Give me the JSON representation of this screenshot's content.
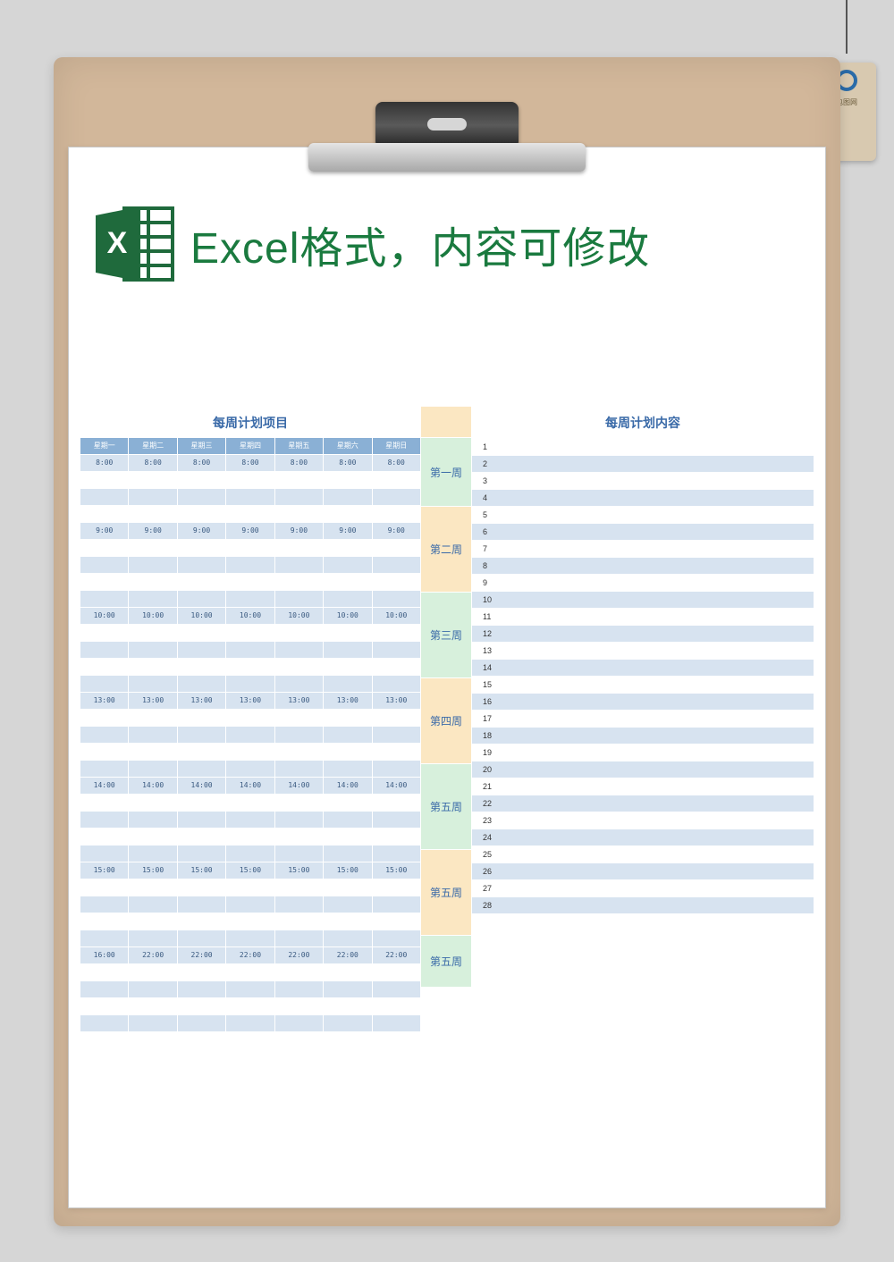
{
  "header_title": "Excel格式，内容可修改",
  "tag_text": "包图网",
  "left_title": "每周计划项目",
  "right_title": "每周计划内容",
  "days": [
    "星期一",
    "星期二",
    "星期三",
    "星期四",
    "星期五",
    "星期六",
    "星期日"
  ],
  "time_blocks": [
    {
      "times": [
        "8:00",
        "8:00",
        "8:00",
        "8:00",
        "8:00",
        "8:00",
        "8:00"
      ]
    },
    {
      "times": [
        "9:00",
        "9:00",
        "9:00",
        "9:00",
        "9:00",
        "9:00",
        "9:00"
      ]
    },
    {
      "times": [
        "10:00",
        "10:00",
        "10:00",
        "10:00",
        "10:00",
        "10:00",
        "10:00"
      ]
    },
    {
      "times": [
        "13:00",
        "13:00",
        "13:00",
        "13:00",
        "13:00",
        "13:00",
        "13:00"
      ]
    },
    {
      "times": [
        "14:00",
        "14:00",
        "14:00",
        "14:00",
        "14:00",
        "14:00",
        "14:00"
      ]
    },
    {
      "times": [
        "15:00",
        "15:00",
        "15:00",
        "15:00",
        "15:00",
        "15:00",
        "15:00"
      ]
    },
    {
      "times": [
        "16:00",
        "22:00",
        "22:00",
        "22:00",
        "22:00",
        "22:00",
        "22:00"
      ]
    }
  ],
  "weeks": [
    "第一周",
    "第二周",
    "第三周",
    "第四周",
    "第五周",
    "第五周",
    "第五周"
  ],
  "content_numbers": [
    "1",
    "2",
    "3",
    "4",
    "5",
    "6",
    "7",
    "8",
    "9",
    "10",
    "11",
    "12",
    "13",
    "14",
    "15",
    "16",
    "17",
    "18",
    "19",
    "20",
    "21",
    "22",
    "23",
    "24",
    "25",
    "26",
    "27",
    "28"
  ]
}
